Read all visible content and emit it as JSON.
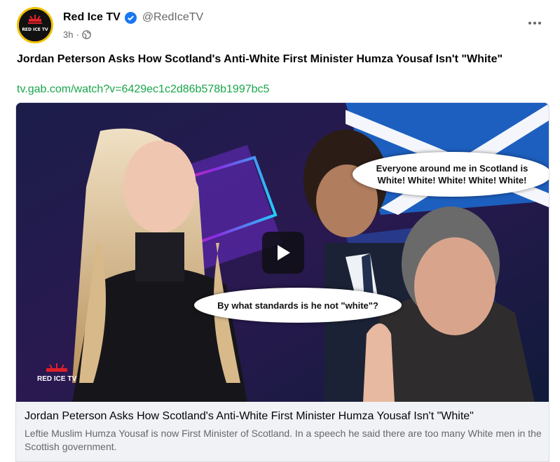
{
  "post": {
    "author_name": "Red Ice TV",
    "author_handle": "@RedIceTV",
    "time": "3h",
    "separator": "·",
    "title": "Jordan Peterson Asks How Scotland's Anti-White First Minister Humza Yousaf Isn't \"White\"",
    "link": "tv.gab.com/watch?v=6429ec1c2d86b578b1997bc5"
  },
  "avatar": {
    "logo_text": "RED ICE TV"
  },
  "media": {
    "bubble_top": "Everyone around me in Scotland is White! White! White! White! White!",
    "bubble_bottom": "By what standards is he not \"white\"?",
    "watermark": "RED ICE TV"
  },
  "link_preview": {
    "title": "Jordan Peterson Asks How Scotland's Anti-White First Minister Humza Yousaf Isn't \"White\"",
    "description": "Leftie Muslim Humza Yousaf is now First Minister of Scotland. In a speech he said there are too many White men in the Scottish government."
  },
  "colors": {
    "verified": "#1877f2",
    "link": "#1aa64a",
    "secondary_text": "#65676b"
  }
}
